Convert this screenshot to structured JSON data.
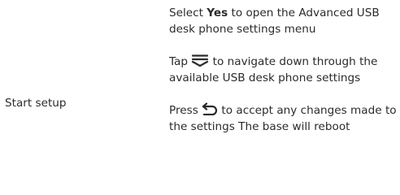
{
  "section": {
    "label": "Start setup"
  },
  "steps": [
    {
      "prefix": "Select ",
      "emphasis": "Yes",
      "suffix": " to open the Advanced USB desk phone settings menu"
    },
    {
      "prefix": "Tap ",
      "icon": "scroll-down-icon",
      "suffix": " to navigate down through the available USB desk phone settings"
    },
    {
      "prefix": "Press ",
      "icon": "back-return-icon",
      "suffix": " to accept any changes made to the settings  The base will reboot"
    }
  ]
}
